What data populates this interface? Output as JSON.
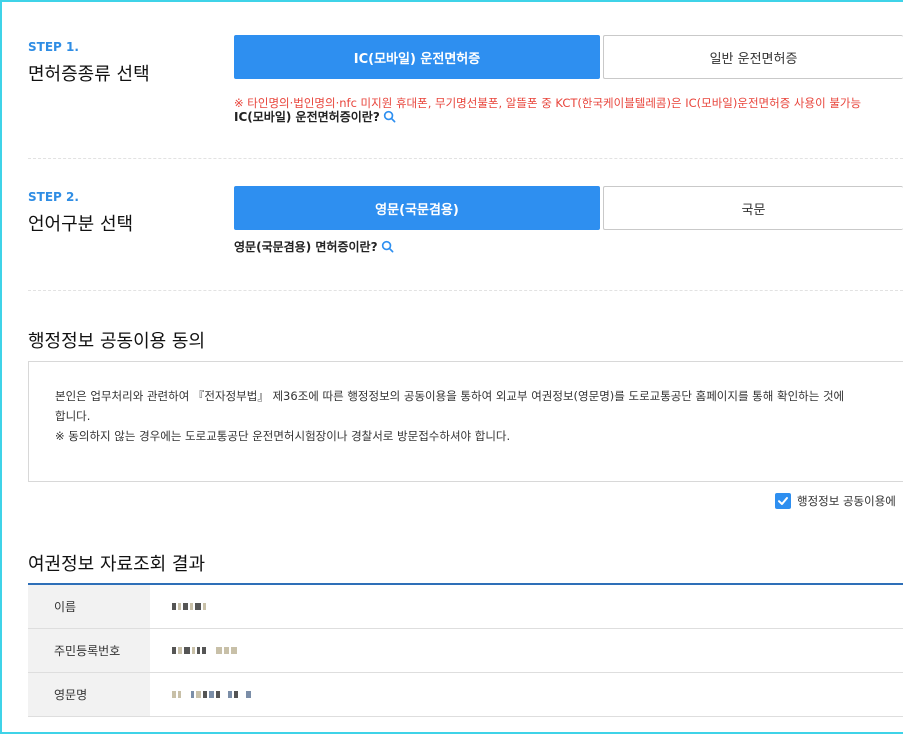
{
  "step1": {
    "label": "STEP 1.",
    "title": "면허증종류 선택",
    "option_active": "IC(모바일) 운전면허증",
    "option_inactive": "일반 운전면허증",
    "warning": "※ 타인명의·법인명의·nfc 미지원 휴대폰, 무기명선불폰, 알뜰폰 중 KCT(한국케이블텔레콤)은 IC(모바일)운전면허증 사용이 불가능",
    "info_link": "IC(모바일) 운전면허증이란?"
  },
  "step2": {
    "label": "STEP 2.",
    "title": "언어구분 선택",
    "option_active": "영문(국문겸용)",
    "option_inactive": "국문",
    "info_link": "영문(국문겸용) 면허증이란?"
  },
  "consent": {
    "title": "행정정보 공동이용 동의",
    "line1": "본인은 업무처리와 관련하여 『전자정부법』 제36조에 따른 행정정보의 공동이용을 통하여 외교부 여권정보(영문명)를 도로교통공단 홈페이지를 통해 확인하는 것에",
    "line2": "합니다.",
    "line3": "※ 동의하지 않는 경우에는 도로교통공단 운전면허시험장이나 경찰서로 방문접수하셔야 합니다.",
    "agree_label": "행정정보 공동이용에"
  },
  "result": {
    "title": "여권정보 자료조회 결과",
    "rows": [
      {
        "label": "이름"
      },
      {
        "label": "주민등록번호"
      },
      {
        "label": "영문명"
      }
    ]
  },
  "colors": {
    "accent": "#2e8ff0",
    "warning": "#e8453c",
    "frame": "#3fd3e8"
  }
}
